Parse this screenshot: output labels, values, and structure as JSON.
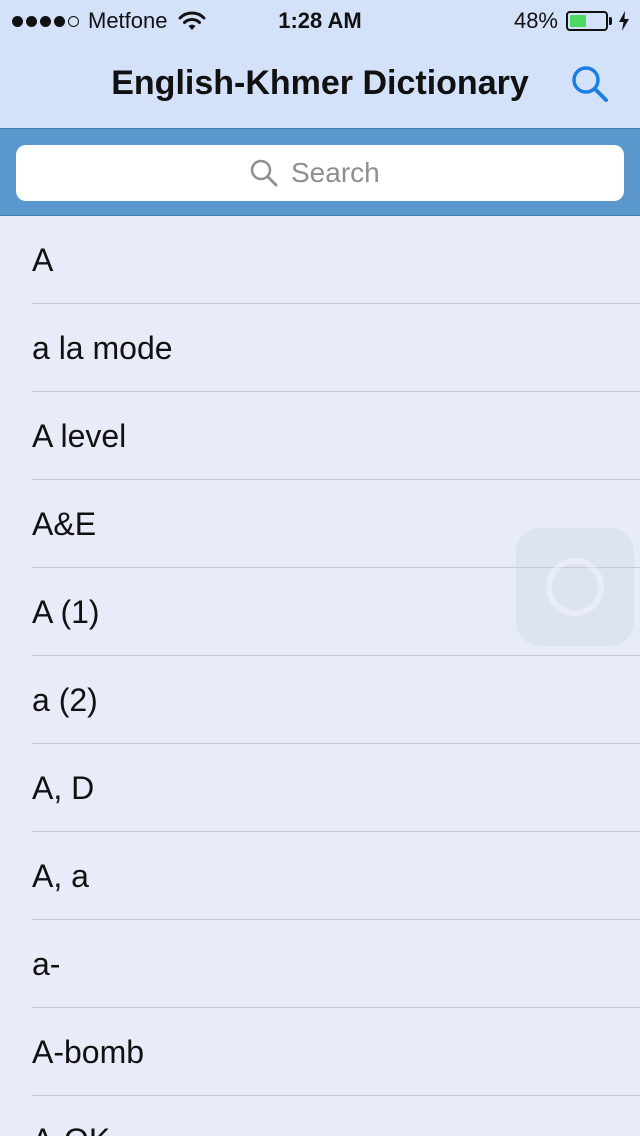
{
  "status_bar": {
    "carrier": "Metfone",
    "time": "1:28 AM",
    "battery_percent_text": "48%",
    "battery_level": 0.48,
    "signal_bars_filled": 4,
    "signal_bars_total": 5
  },
  "nav": {
    "title": "English-Khmer Dictionary",
    "search_icon": "search-icon"
  },
  "search": {
    "placeholder": "Search",
    "value": ""
  },
  "words": [
    {
      "label": "A"
    },
    {
      "label": "a la mode"
    },
    {
      "label": "A level"
    },
    {
      "label": "A&E"
    },
    {
      "label": "A (1)"
    },
    {
      "label": "a (2)"
    },
    {
      "label": "A, D"
    },
    {
      "label": "A, a"
    },
    {
      "label": "a-"
    },
    {
      "label": "A-bomb"
    },
    {
      "label": "A-OK"
    }
  ],
  "colors": {
    "header_bg": "#d4e2f9",
    "searchbar_bg": "#5a97cd",
    "list_bg": "#e7ecf8",
    "accent": "#1a7fe0",
    "battery": "#4cd964"
  }
}
